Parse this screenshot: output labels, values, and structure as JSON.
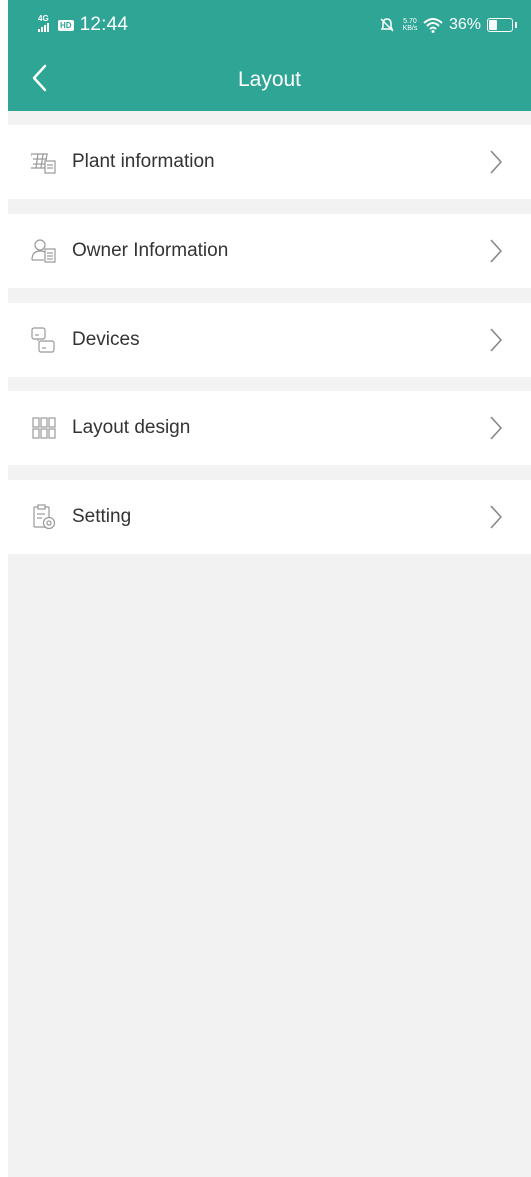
{
  "status_bar": {
    "network": "4G",
    "hd_badge": "HD",
    "time": "12:44",
    "speed": "5.70 KB/s",
    "battery": "36%",
    "mute_icon": "bell-off-icon",
    "wifi_icon": "wifi-icon",
    "battery_icon": "battery-icon"
  },
  "header": {
    "title": "Layout",
    "back_icon": "chevron-left-icon",
    "color": "#2ea595"
  },
  "menu": {
    "items": [
      {
        "label": "Plant information",
        "icon": "plant-info-icon"
      },
      {
        "label": "Owner Information",
        "icon": "owner-info-icon"
      },
      {
        "label": "Devices",
        "icon": "devices-icon"
      },
      {
        "label": "Layout design",
        "icon": "layout-grid-icon"
      },
      {
        "label": "Setting",
        "icon": "setting-icon"
      }
    ],
    "chevron_icon": "chevron-right-icon"
  }
}
